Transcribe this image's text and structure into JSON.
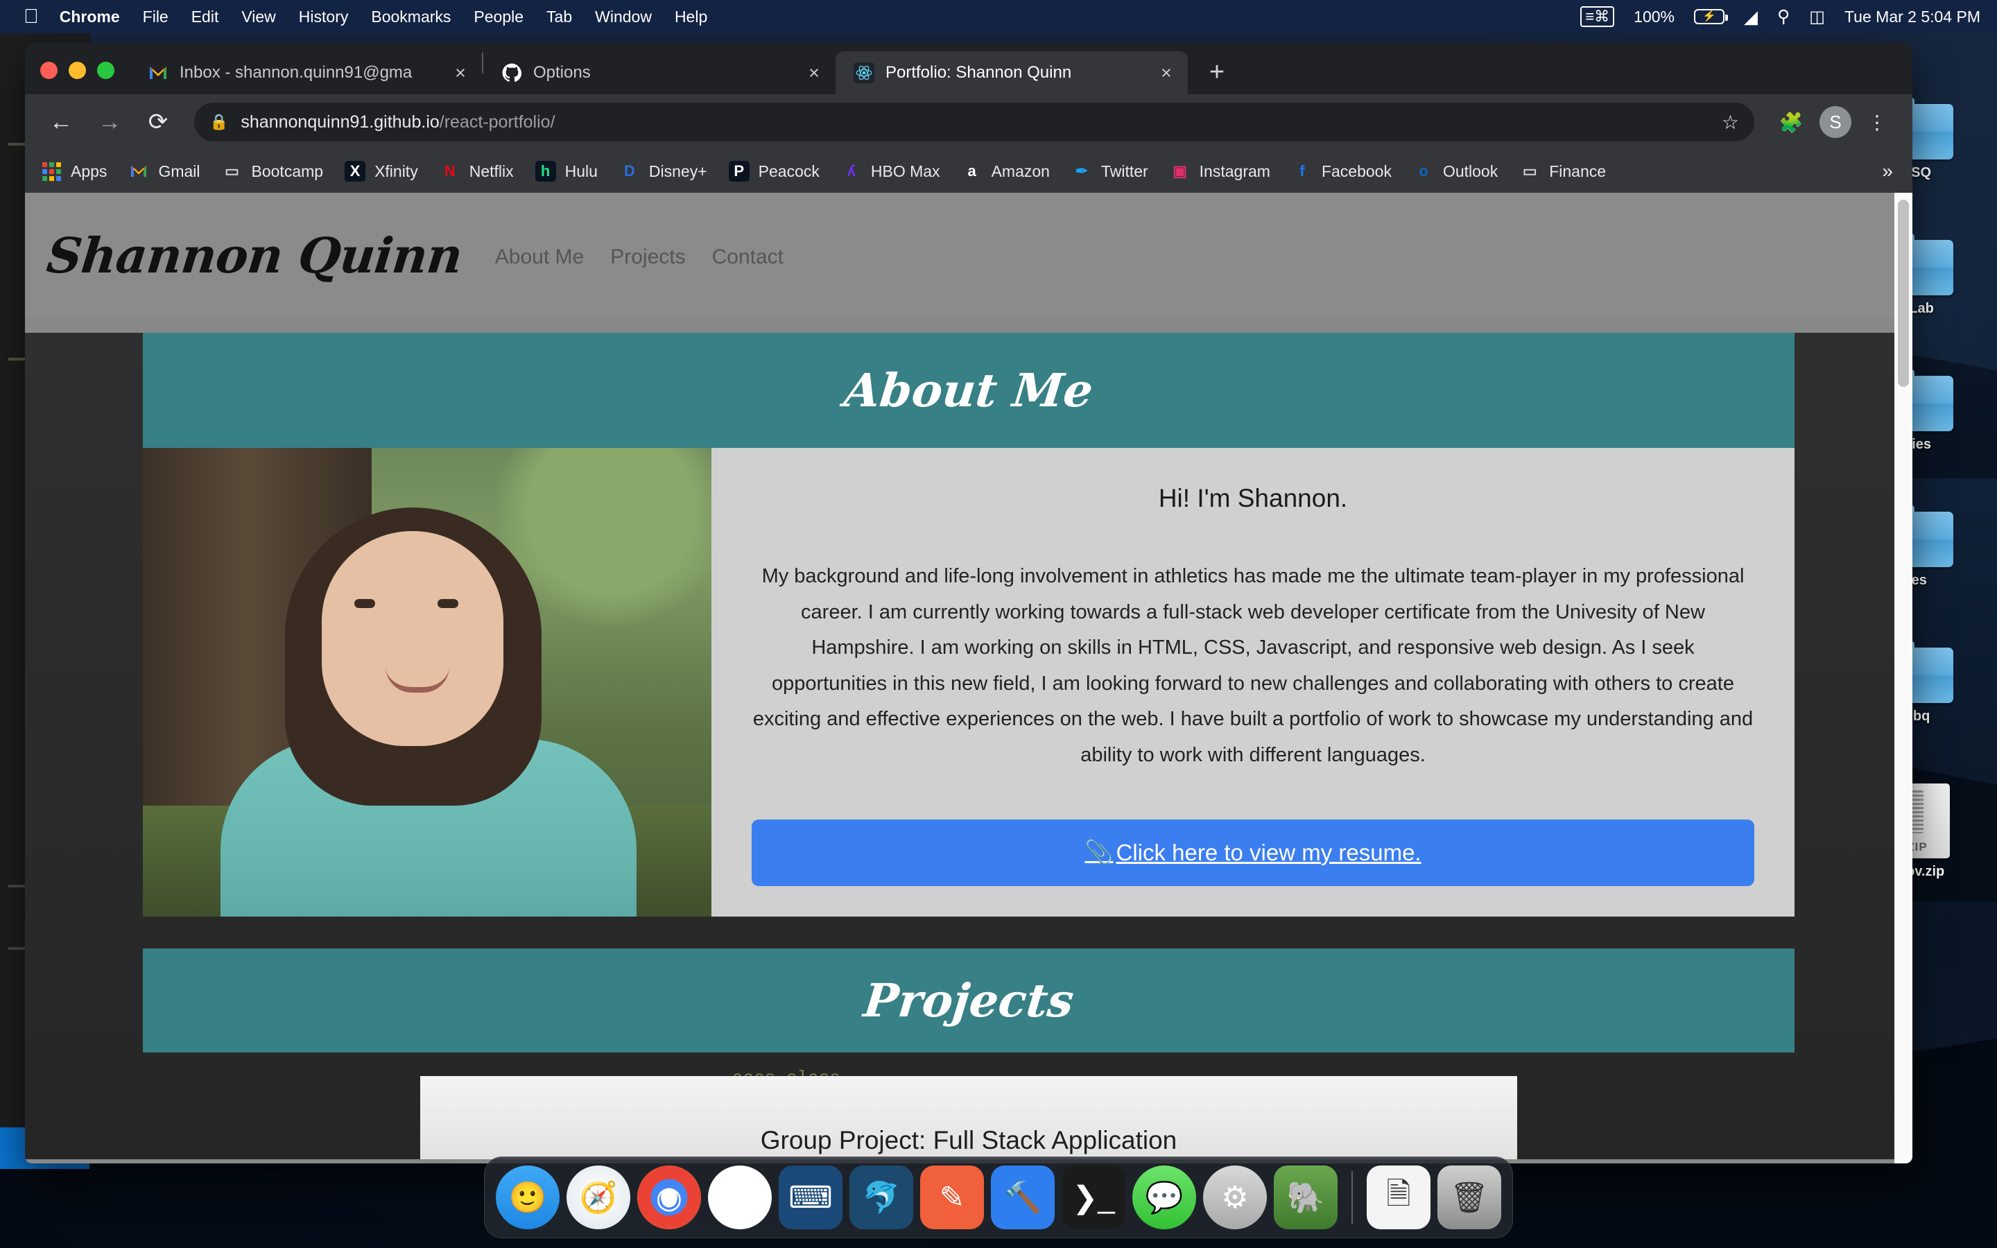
{
  "menubar": {
    "apple_icon": "apple-icon",
    "items": [
      "Chrome",
      "File",
      "Edit",
      "View",
      "History",
      "Bookmarks",
      "People",
      "Tab",
      "Window",
      "Help"
    ],
    "status": {
      "screenshot_icon": "screenshot-icon",
      "battery_percent": "100%",
      "battery_icon": "battery-charging-icon",
      "wifi_icon": "wifi-icon",
      "search_icon": "search-icon",
      "control_center_icon": "control-center-icon",
      "clock": "Tue Mar 2  5:04 PM"
    }
  },
  "browser": {
    "tabs": [
      {
        "favicon": "gmail-icon",
        "title": "Inbox - shannon.quinn91@gma",
        "close": "×",
        "active": false
      },
      {
        "favicon": "github-icon",
        "title": "Options",
        "close": "×",
        "active": false
      },
      {
        "favicon": "react-icon",
        "title": "Portfolio: Shannon Quinn",
        "close": "×",
        "active": true
      }
    ],
    "new_tab_label": "+",
    "nav": {
      "back": "←",
      "forward": "→",
      "reload": "⟳"
    },
    "omnibox": {
      "lock_icon": "lock-icon",
      "url_host": "shannonquinn91.github.io",
      "url_path": "/react-portfolio/",
      "star_icon": "star-icon"
    },
    "toolbar_icons": {
      "extensions": "puzzle-icon",
      "profile_initial": "S",
      "menu": "kebab-menu-icon"
    },
    "bookmarks": [
      {
        "label": "Apps",
        "icon": "apps-grid-icon"
      },
      {
        "label": "Gmail",
        "icon": "gmail-icon"
      },
      {
        "label": "Bootcamp",
        "icon": "folder-icon"
      },
      {
        "label": "Xfinity",
        "icon": "xfinity-icon"
      },
      {
        "label": "Netflix",
        "icon": "netflix-icon"
      },
      {
        "label": "Hulu",
        "icon": "hulu-icon"
      },
      {
        "label": "Disney+",
        "icon": "disneyplus-icon"
      },
      {
        "label": "Peacock",
        "icon": "peacock-icon"
      },
      {
        "label": "HBO Max",
        "icon": "hbomax-icon"
      },
      {
        "label": "Amazon",
        "icon": "amazon-icon"
      },
      {
        "label": "Twitter",
        "icon": "twitter-icon"
      },
      {
        "label": "Instagram",
        "icon": "instagram-icon"
      },
      {
        "label": "Facebook",
        "icon": "facebook-icon"
      },
      {
        "label": "Outlook",
        "icon": "outlook-icon"
      },
      {
        "label": "Finance",
        "icon": "folder-icon"
      }
    ],
    "bookmarks_overflow": "»"
  },
  "page": {
    "brand": "Shannon Quinn",
    "nav": [
      "About Me",
      "Projects",
      "Contact"
    ],
    "about": {
      "band_title": "About Me",
      "heading": "Hi! I'm Shannon.",
      "paragraph": "My background and life-long involvement in athletics has made me the ultimate team-player in my professional career. I am currently working towards a full-stack web developer certificate from the Univesity of New Hampshire. I am working on skills in HTML, CSS, Javascript, and responsive web design. As I seek opportunities in this new field, I am looking forward to new challenges and collaborating with others to create exciting and effective experiences on the web. I have built a portfolio of work to showcase my understanding and ability to work with different languages.",
      "resume_button": "Click here to view my resume.",
      "resume_icon": "paperclip-icon",
      "photo_alt": "portrait-photo"
    },
    "projects": {
      "band_title": "Projects",
      "cards": [
        {
          "title": "Group Project: Full Stack Application"
        }
      ]
    },
    "colors": {
      "band_teal": "#378085",
      "header_gray": "#8b8b8b",
      "card_gray": "#d0d0d0",
      "resume_blue": "#3b7ef0"
    },
    "scrollbar": "page-scrollbar"
  },
  "desktop": {
    "icons": [
      {
        "label": "_SQ",
        "type": "folder"
      },
      {
        "label": "itLab",
        "type": "folder"
      },
      {
        "label": "ities",
        "type": "folder"
      },
      {
        "label": "ies",
        "type": "folder"
      },
      {
        "label": "ubq",
        "type": "folder"
      },
      {
        "label": "neov.zip",
        "type": "zip",
        "badge": "ZIP"
      }
    ]
  },
  "dock": {
    "items": [
      {
        "name": "finder",
        "glyph": "🙂",
        "running": true
      },
      {
        "name": "safari",
        "glyph": "🧭",
        "running": false
      },
      {
        "name": "chrome",
        "glyph": "◉",
        "running": true
      },
      {
        "name": "slack",
        "glyph": "⌗",
        "running": true
      },
      {
        "name": "visual-studio-code",
        "glyph": "⌨",
        "running": true
      },
      {
        "name": "mysql-workbench",
        "glyph": "🐬",
        "running": false
      },
      {
        "name": "sketch",
        "glyph": "✎",
        "running": false
      },
      {
        "name": "xcode",
        "glyph": "🔨",
        "running": false
      },
      {
        "name": "terminal",
        "glyph": "❯_",
        "running": true
      },
      {
        "name": "messages",
        "glyph": "💬",
        "running": false
      },
      {
        "name": "system-preferences",
        "glyph": "⚙",
        "running": false
      },
      {
        "name": "evernote",
        "glyph": "🐘",
        "running": false
      }
    ],
    "extras": [
      {
        "name": "document",
        "glyph": "🗎"
      },
      {
        "name": "trash",
        "glyph": "🗑"
      }
    ]
  }
}
